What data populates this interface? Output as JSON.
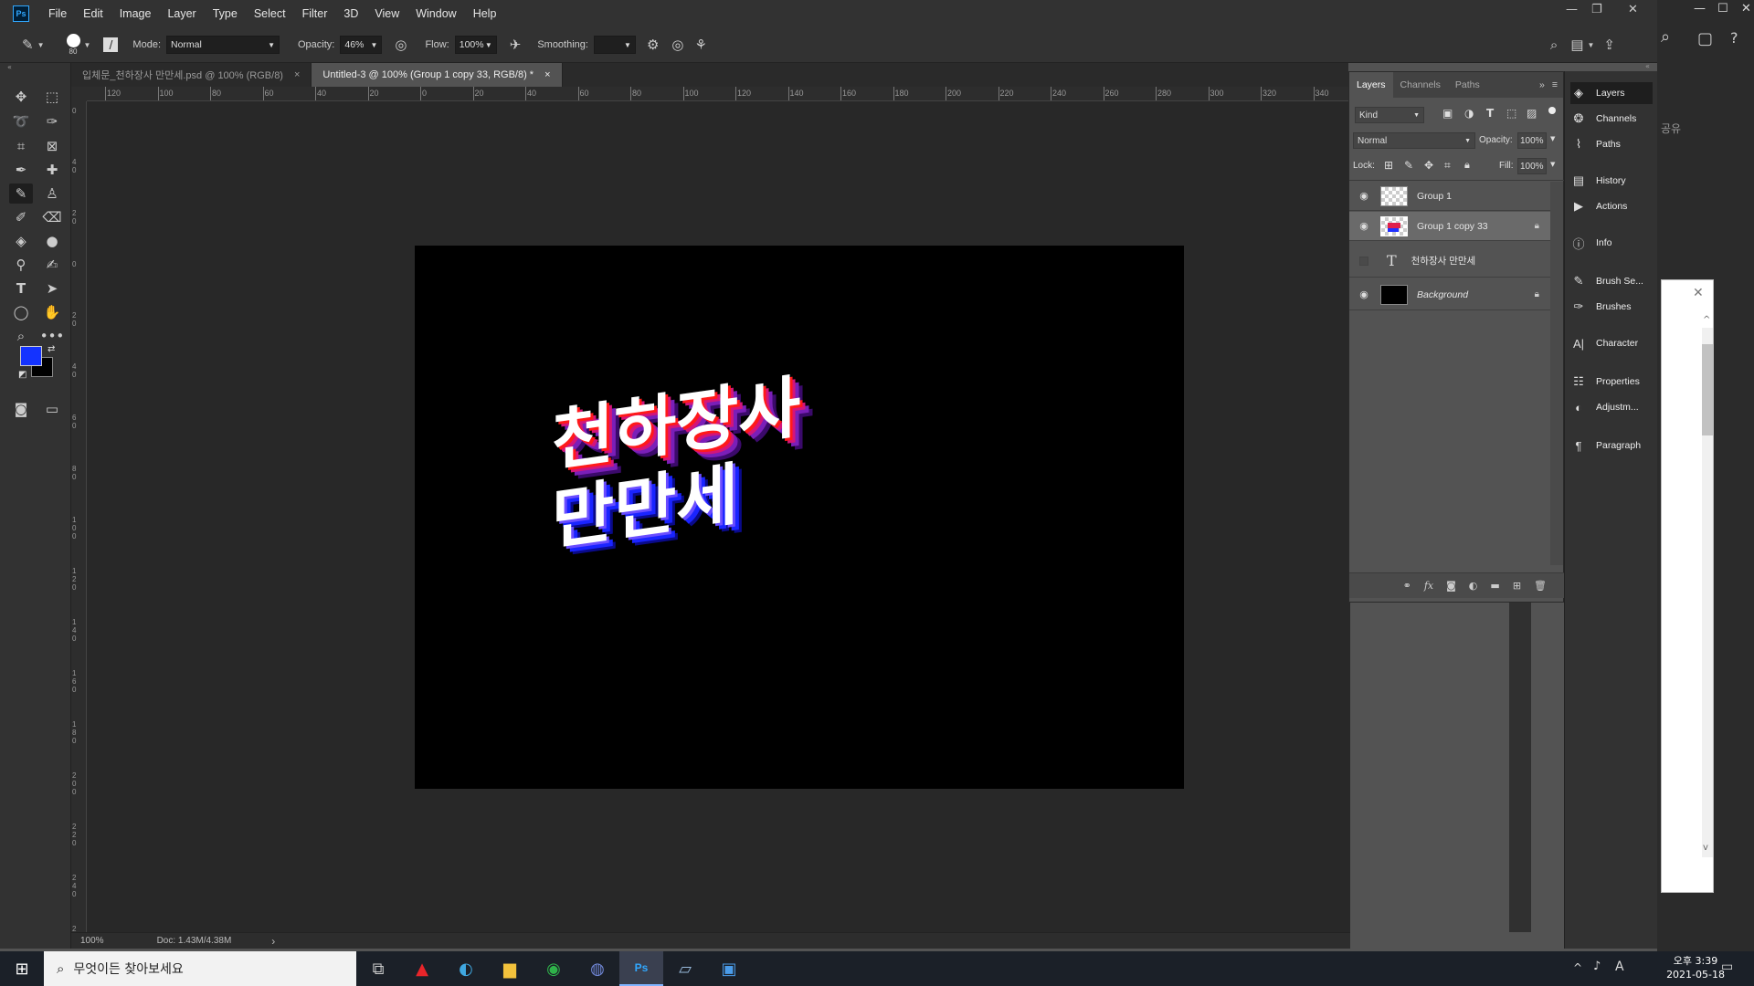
{
  "menubar": {
    "logo": "Ps",
    "items": [
      "File",
      "Edit",
      "Image",
      "Layer",
      "Type",
      "Select",
      "Filter",
      "3D",
      "View",
      "Window",
      "Help"
    ]
  },
  "options": {
    "brush_size": "80",
    "mode_label": "Mode:",
    "mode_value": "Normal",
    "opacity_label": "Opacity:",
    "opacity_value": "46%",
    "flow_label": "Flow:",
    "flow_value": "100%",
    "smoothing_label": "Smoothing:"
  },
  "tabs": [
    {
      "label": "입체문_천하장사 만만세.psd @ 100% (RGB/8)",
      "close": "×"
    },
    {
      "label": "Untitled-3 @ 100% (Group 1 copy 33, RGB/8) *",
      "close": "×"
    }
  ],
  "ruler_top": [
    "120",
    "100",
    "80",
    "60",
    "40",
    "20",
    "0",
    "20",
    "40",
    "60",
    "80",
    "100",
    "120",
    "140",
    "160",
    "180",
    "200",
    "220",
    "240",
    "260",
    "280",
    "300",
    "320",
    "340"
  ],
  "ruler_left": [
    "0",
    "40",
    "20",
    "0",
    "20",
    "40",
    "60",
    "80",
    "100",
    "120",
    "140",
    "160",
    "180",
    "200",
    "220",
    "240",
    "2"
  ],
  "artwork": {
    "line1": "천하장사",
    "line2": "만만세"
  },
  "status": {
    "zoom": "100%",
    "doc": "Doc: 1.43M/4.38M",
    "arrow": "›"
  },
  "layers_panel": {
    "tabs": [
      "Layers",
      "Channels",
      "Paths"
    ],
    "kind": "Kind",
    "blend": "Normal",
    "opacity_label": "Opacity:",
    "opacity_value": "100%",
    "lock_label": "Lock:",
    "fill_label": "Fill:",
    "fill_value": "100%",
    "layers": [
      {
        "name": "Group 1"
      },
      {
        "name": "Group 1 copy 33"
      },
      {
        "name": "천하장사 만만세"
      },
      {
        "name": "Background"
      }
    ]
  },
  "right_panels": [
    "Layers",
    "Channels",
    "Paths",
    "History",
    "Actions",
    "Info",
    "Brush Se...",
    "Brushes",
    "Character",
    "Properties",
    "Adjustm...",
    "Paragraph"
  ],
  "background_app": {
    "text": "공유"
  },
  "taskbar": {
    "search_placeholder": "무엇이든 찾아보세요",
    "time": "오후 3:39",
    "date": "2021-05-18",
    "ime": "A"
  }
}
